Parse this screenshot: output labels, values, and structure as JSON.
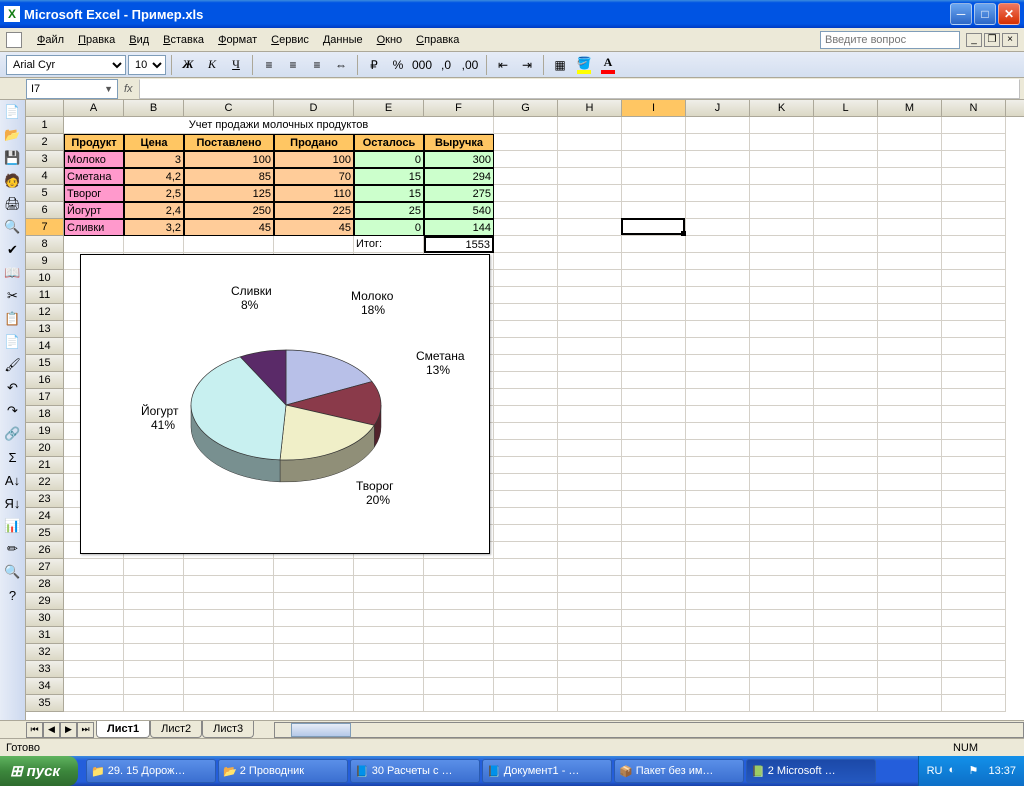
{
  "window": {
    "title": "Microsoft Excel - Пример.xls"
  },
  "menu": {
    "items": [
      "Файл",
      "Правка",
      "Вид",
      "Вставка",
      "Формат",
      "Сервис",
      "Данные",
      "Окно",
      "Справка"
    ],
    "help_placeholder": "Введите вопрос"
  },
  "formatting": {
    "font": "Arial Cyr",
    "size": "10"
  },
  "name_box": "I7",
  "formula": "",
  "columns": [
    "A",
    "B",
    "C",
    "D",
    "E",
    "F",
    "G",
    "H",
    "I",
    "J",
    "K",
    "L",
    "M",
    "N"
  ],
  "active_col": "I",
  "active_row": 7,
  "table": {
    "title": "Учет продажи молочных продуктов",
    "headers": [
      "Продукт",
      "Цена",
      "Поставлено",
      "Продано",
      "Осталось",
      "Выручка"
    ],
    "rows": [
      {
        "p": "Молоко",
        "c": "3",
        "d": "100",
        "s": "100",
        "o": "0",
        "r": "300"
      },
      {
        "p": "Сметана",
        "c": "4,2",
        "d": "85",
        "s": "70",
        "o": "15",
        "r": "294"
      },
      {
        "p": "Творог",
        "c": "2,5",
        "d": "125",
        "s": "110",
        "o": "15",
        "r": "275"
      },
      {
        "p": "Йогурт",
        "c": "2,4",
        "d": "250",
        "s": "225",
        "o": "25",
        "r": "540"
      },
      {
        "p": "Сливки",
        "c": "3,2",
        "d": "45",
        "s": "45",
        "o": "0",
        "r": "144"
      }
    ],
    "total_label": "Итог:",
    "total": "1553"
  },
  "chart_data": {
    "type": "pie",
    "title": "",
    "series": [
      {
        "name": "Молоко",
        "value": 18,
        "label": "Молоко\n18%",
        "color": "#b8c0e8"
      },
      {
        "name": "Сметана",
        "value": 13,
        "label": "Сметана\n13%",
        "color": "#8a3a4a"
      },
      {
        "name": "Творог",
        "value": 20,
        "label": "Творог\n20%",
        "color": "#f0efc8"
      },
      {
        "name": "Йогурт",
        "value": 41,
        "label": "Йогурт\n41%",
        "color": "#c8f0f0"
      },
      {
        "name": "Сливки",
        "value": 8,
        "label": "Сливки\n8%",
        "color": "#5a2a68"
      }
    ]
  },
  "sheets": {
    "tabs": [
      "Лист1",
      "Лист2",
      "Лист3"
    ],
    "active": 0
  },
  "status": {
    "ready": "Готово",
    "num": "NUM"
  },
  "taskbar": {
    "start": "пуск",
    "items": [
      "29. 15 Дорож…",
      "2 Проводник",
      "30 Расчеты с …",
      "Документ1 - …",
      "Пакет без им…",
      "2 Microsoft …"
    ],
    "active_item": 5,
    "lang": "RU",
    "clock": "13:37"
  }
}
